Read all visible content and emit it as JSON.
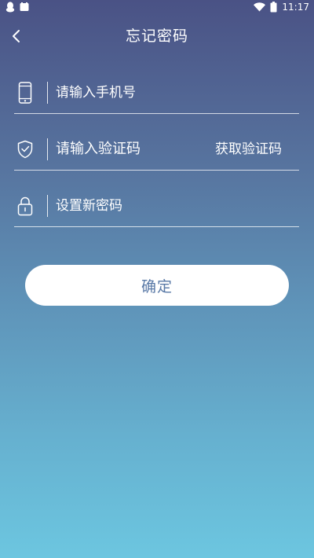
{
  "status_bar": {
    "time": "11:17",
    "icons": [
      "qq-icon",
      "notification-icon",
      "wifi-icon",
      "battery-icon"
    ]
  },
  "header": {
    "title": "忘记密码",
    "back_icon": "chevron-left-icon"
  },
  "form": {
    "phone": {
      "placeholder": "请输入手机号",
      "value": "",
      "icon": "phone-icon"
    },
    "code": {
      "placeholder": "请输入验证码",
      "value": "",
      "icon": "shield-check-icon",
      "get_code_label": "获取验证码"
    },
    "new_password": {
      "placeholder": "设置新密码",
      "value": "",
      "icon": "lock-icon"
    }
  },
  "actions": {
    "confirm_label": "确定"
  },
  "colors": {
    "gradient_top": "#4a5285",
    "gradient_bottom": "#6cc6e0",
    "button_text": "#5878a6",
    "button_bg": "#ffffff"
  }
}
